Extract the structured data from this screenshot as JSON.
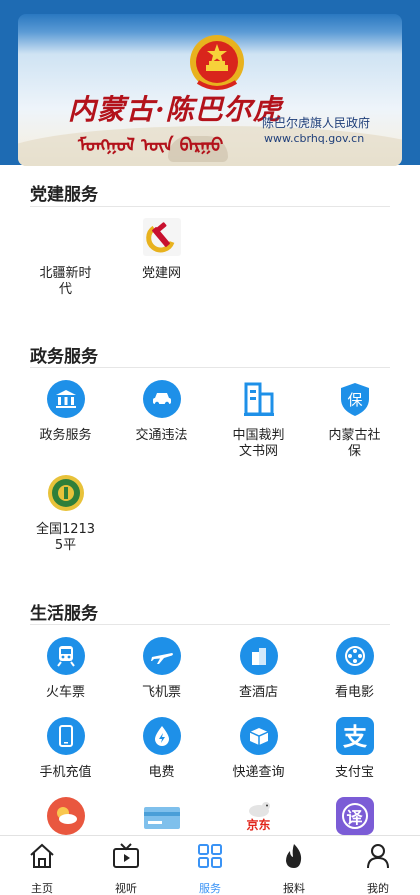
{
  "banner": {
    "title_calligraphy": "内蒙古·陈巴尔虎",
    "mongolian_text": "ᠮᠣᠩᠭᠣᠯ ᠦᠨ ᠪᠠᠷᠭᠤ",
    "gov_name": "陈巴尔虎旗人民政府",
    "gov_url": "www.cbrhq.gov.cn"
  },
  "sections": {
    "party": {
      "title": "党建服务",
      "items": [
        {
          "label": "北疆新时代",
          "icon": "newspaper-icon"
        },
        {
          "label": "党建网",
          "icon": "hammer-sickle-icon"
        }
      ]
    },
    "gov": {
      "title": "政务服务",
      "items": [
        {
          "label": "政务服务",
          "icon": "government-building-icon"
        },
        {
          "label": "交通违法",
          "icon": "car-icon"
        },
        {
          "label": "中国裁判文书网",
          "icon": "court-building-icon"
        },
        {
          "label": "内蒙古社保",
          "icon": "social-security-icon"
        },
        {
          "label": "全国12135平",
          "icon": "consumer-protection-icon"
        }
      ]
    },
    "life": {
      "title": "生活服务",
      "items": [
        {
          "label": "火车票",
          "icon": "train-icon"
        },
        {
          "label": "飞机票",
          "icon": "airplane-icon"
        },
        {
          "label": "查酒店",
          "icon": "hotel-icon"
        },
        {
          "label": "看电影",
          "icon": "film-reel-icon"
        },
        {
          "label": "手机充值",
          "icon": "phone-icon"
        },
        {
          "label": "电费",
          "icon": "electricity-icon"
        },
        {
          "label": "快递查询",
          "icon": "package-icon"
        },
        {
          "label": "支付宝",
          "icon": "alipay-icon"
        },
        {
          "label": "",
          "icon": "weather-icon"
        },
        {
          "label": "",
          "icon": "card-icon"
        },
        {
          "label": "",
          "icon": "jd-icon"
        },
        {
          "label": "",
          "icon": "translate-icon"
        }
      ],
      "partial_texts": {
        "jd": "京东",
        "translate": "译"
      }
    }
  },
  "tabbar": {
    "items": [
      {
        "label": "主页",
        "icon": "home-icon"
      },
      {
        "label": "视听",
        "icon": "tv-icon"
      },
      {
        "label": "服务",
        "icon": "grid-icon",
        "active": true
      },
      {
        "label": "报料",
        "icon": "fire-icon"
      },
      {
        "label": "我的",
        "icon": "user-icon"
      }
    ]
  },
  "colors": {
    "primary_blue": "#1e90e8",
    "header_blue": "#1e6bb3",
    "active_tab": "#3a93f5",
    "calligraphy_red": "#b3121b"
  }
}
